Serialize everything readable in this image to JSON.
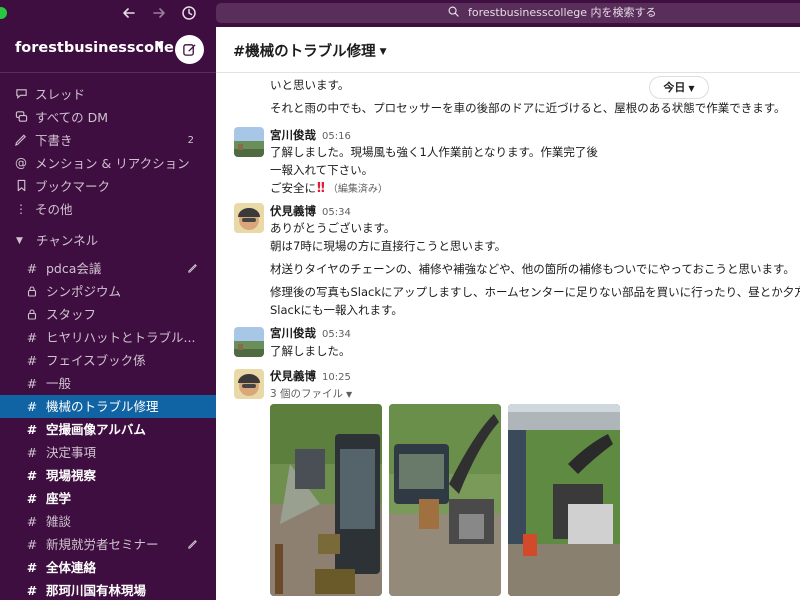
{
  "topbar": {
    "search_text": "forestbusinesscollege 内を検索する"
  },
  "workspace": {
    "name": "forestbusinesscolle..."
  },
  "nav": {
    "items": [
      {
        "label": "スレッド",
        "icon": "threads-icon",
        "count": ""
      },
      {
        "label": "すべての DM",
        "icon": "dm-icon",
        "count": ""
      },
      {
        "label": "下書き",
        "icon": "drafts-icon",
        "count": "2"
      },
      {
        "label": "メンション & リアクション",
        "icon": "mention-icon",
        "count": ""
      },
      {
        "label": "ブックマーク",
        "icon": "bookmark-icon",
        "count": ""
      },
      {
        "label": "その他",
        "icon": "more-icon",
        "count": ""
      }
    ]
  },
  "channels_section": {
    "label": "チャンネル",
    "items": [
      {
        "label": "pdca会議",
        "type": "public",
        "state": "normal"
      },
      {
        "label": "シンポジウム",
        "type": "private",
        "state": "normal"
      },
      {
        "label": "スタッフ",
        "type": "private",
        "state": "normal"
      },
      {
        "label": "ヒヤリハットとトラブル...",
        "type": "public",
        "state": "normal"
      },
      {
        "label": "フェイスブック係",
        "type": "public",
        "state": "normal"
      },
      {
        "label": "一般",
        "type": "public",
        "state": "normal"
      },
      {
        "label": "機械のトラブル修理",
        "type": "public",
        "state": "active"
      },
      {
        "label": "空撮画像アルバム",
        "type": "public",
        "state": "unread"
      },
      {
        "label": "決定事項",
        "type": "public",
        "state": "normal"
      },
      {
        "label": "現場視察",
        "type": "public",
        "state": "unread"
      },
      {
        "label": "座学",
        "type": "public",
        "state": "unread"
      },
      {
        "label": "雑談",
        "type": "public",
        "state": "normal"
      },
      {
        "label": "新規就労者セミナー",
        "type": "public",
        "state": "normal"
      },
      {
        "label": "全体連絡",
        "type": "public",
        "state": "unread"
      },
      {
        "label": "那珂川国有林現場",
        "type": "public",
        "state": "unread"
      }
    ]
  },
  "channel": {
    "title": "機械のトラブル修理",
    "date_divider": "今日"
  },
  "messages": {
    "m0": {
      "lines": [
        "いと思います。",
        "それと雨の中でも、プロセッサーを車の後部のドアに近づけると、屋根のある状態で作業できます。"
      ]
    },
    "m1": {
      "author": "宮川俊哉",
      "time": "05:16",
      "lines": [
        "了解しました。現場風も強く1人作業前となります。作業完了後",
        "一報入れて下さい。",
        "ご安全に"
      ],
      "edited": "（編集済み）"
    },
    "m2": {
      "author": "伏見義博",
      "time": "05:34",
      "lines": [
        "ありがとうございます。",
        "朝は7時に現場の方に直接行こうと思います。",
        "材送りタイヤのチェーンの、補修や補強などや、他の箇所の補修もついでにやっておこうと思います。",
        "修理後の写真もSlackにアップしますし、ホームセンターに足りない部品を買いに行ったり、昼とか夕方",
        "Slackにも一報入れます。"
      ]
    },
    "m3": {
      "author": "宮川俊哉",
      "time": "05:34",
      "lines": [
        "了解しました。"
      ]
    },
    "m4": {
      "author": "伏見義博",
      "time": "10:25",
      "files_label": "3 個のファイル"
    }
  },
  "colors": {
    "sidebar_bg": "#3f0e40",
    "active_channel": "#1164a3",
    "accent_red": "#e01e3c"
  }
}
